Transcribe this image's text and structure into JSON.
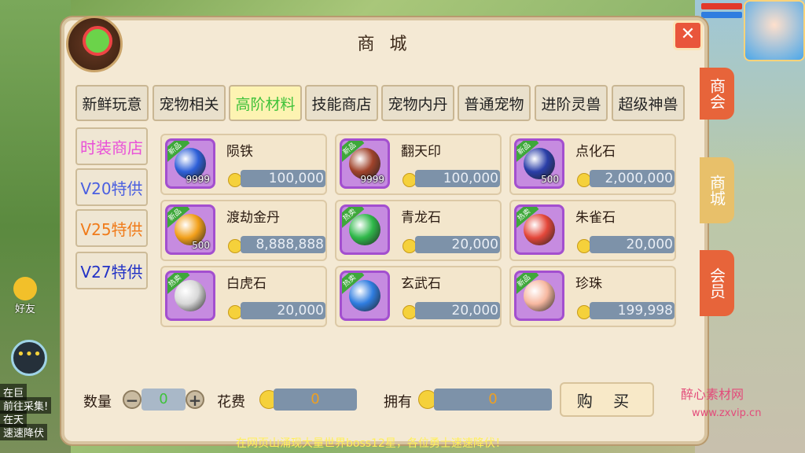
{
  "title": "商 城",
  "tabs": [
    {
      "label": "新鲜玩意",
      "active": false
    },
    {
      "label": "宠物相关",
      "active": false
    },
    {
      "label": "高阶材料",
      "active": true
    },
    {
      "label": "技能商店",
      "active": false
    },
    {
      "label": "宠物内丹",
      "active": false
    },
    {
      "label": "普通宠物",
      "active": false
    },
    {
      "label": "进阶灵兽",
      "active": false
    },
    {
      "label": "超级神兽",
      "active": false
    }
  ],
  "side_tabs": [
    {
      "label": "时装商店",
      "color": "#e94fd8"
    },
    {
      "label": "V20特供",
      "color": "#4a5fe0"
    },
    {
      "label": "V25特供",
      "color": "#f07b1a"
    },
    {
      "label": "V27特供",
      "color": "#2232c6"
    }
  ],
  "items": [
    {
      "name": "陨铁",
      "price": "100,000",
      "badge": "新品",
      "stack": "9999",
      "gem_color": "#2d5fd8"
    },
    {
      "name": "翻天印",
      "price": "100,000",
      "badge": "新品",
      "stack": "9999",
      "gem_color": "#a0432b"
    },
    {
      "name": "点化石",
      "price": "2,000,000",
      "badge": "新品",
      "stack": "500",
      "gem_color": "#2a3ea8"
    },
    {
      "name": "渡劫金丹",
      "price": "8,888,888",
      "badge": "新品",
      "stack": "500",
      "gem_color": "#f2a01a"
    },
    {
      "name": "青龙石",
      "price": "20,000",
      "badge": "热卖",
      "stack": "",
      "gem_color": "#2fb84a"
    },
    {
      "name": "朱雀石",
      "price": "20,000",
      "badge": "热卖",
      "stack": "",
      "gem_color": "#e4473a"
    },
    {
      "name": "白虎石",
      "price": "20,000",
      "badge": "热卖",
      "stack": "",
      "gem_color": "#d8d8d8"
    },
    {
      "name": "玄武石",
      "price": "20,000",
      "badge": "热卖",
      "stack": "",
      "gem_color": "#2f7de0"
    },
    {
      "name": "珍珠",
      "price": "199,998",
      "badge": "新品",
      "stack": "",
      "gem_color": "#f7b8a0"
    }
  ],
  "right_tabs": [
    {
      "label": "商会",
      "color": "#e7643a"
    },
    {
      "label": "商城",
      "color": "#e8c06a"
    },
    {
      "label": "会员",
      "color": "#e7643a"
    }
  ],
  "bottom": {
    "quantity_label": "数量",
    "quantity_value": "0",
    "minus": "−",
    "plus": "+",
    "cost_label": "花费",
    "cost_value": "0",
    "own_label": "拥有",
    "own_value": "0",
    "buy_label": "购 买"
  },
  "hud": {
    "friend_label": "好友",
    "chat_lines": [
      "在巨",
      "前往采集!",
      "在天",
      "速速降伏"
    ],
    "ticker": "在网页山涌现大量世界boss12星，各位勇士速速降伏！",
    "watermark": "醉心素材网",
    "watermark_url": "www.zxvip.cn"
  }
}
